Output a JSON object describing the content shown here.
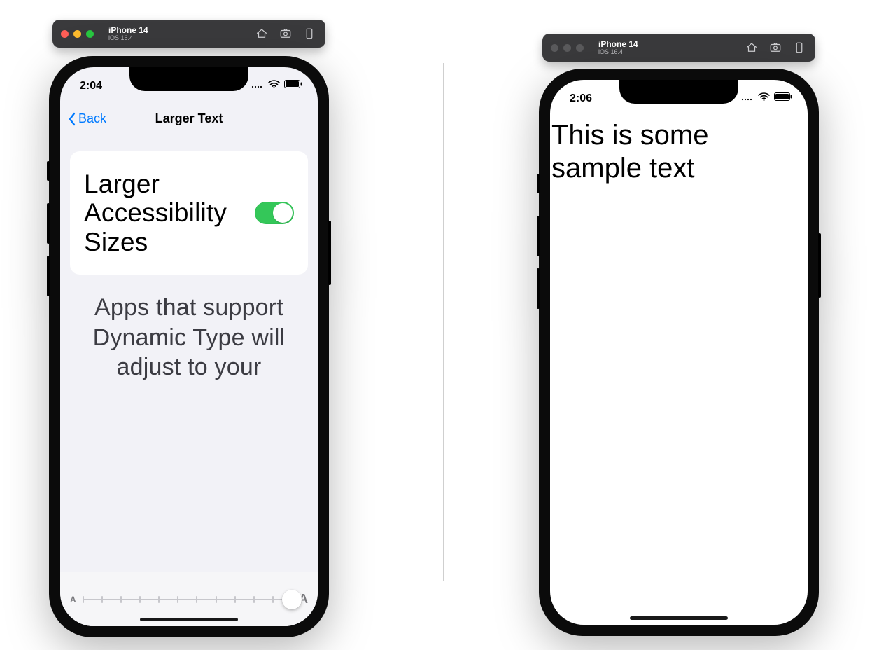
{
  "left": {
    "titlebar": {
      "device": "iPhone 14",
      "os": "iOS 16.4",
      "active": true,
      "dots": {
        "close": "#ff5f57",
        "min": "#febc2e",
        "max": "#28c840"
      }
    },
    "status": {
      "time": "2:04"
    },
    "nav": {
      "back": "Back",
      "title": "Larger Text"
    },
    "cell": {
      "label": "Larger Accessi­bility Sizes",
      "toggle_on": true
    },
    "footer": "Apps that support Dynamic Type will adjust to your",
    "slider": {
      "ticks": 12,
      "position_index": 11,
      "small": "A",
      "big": "A"
    }
  },
  "right": {
    "titlebar": {
      "device": "iPhone 14",
      "os": "iOS 16.4",
      "active": false
    },
    "status": {
      "time": "2:06"
    },
    "sample": "This is some sample text"
  }
}
